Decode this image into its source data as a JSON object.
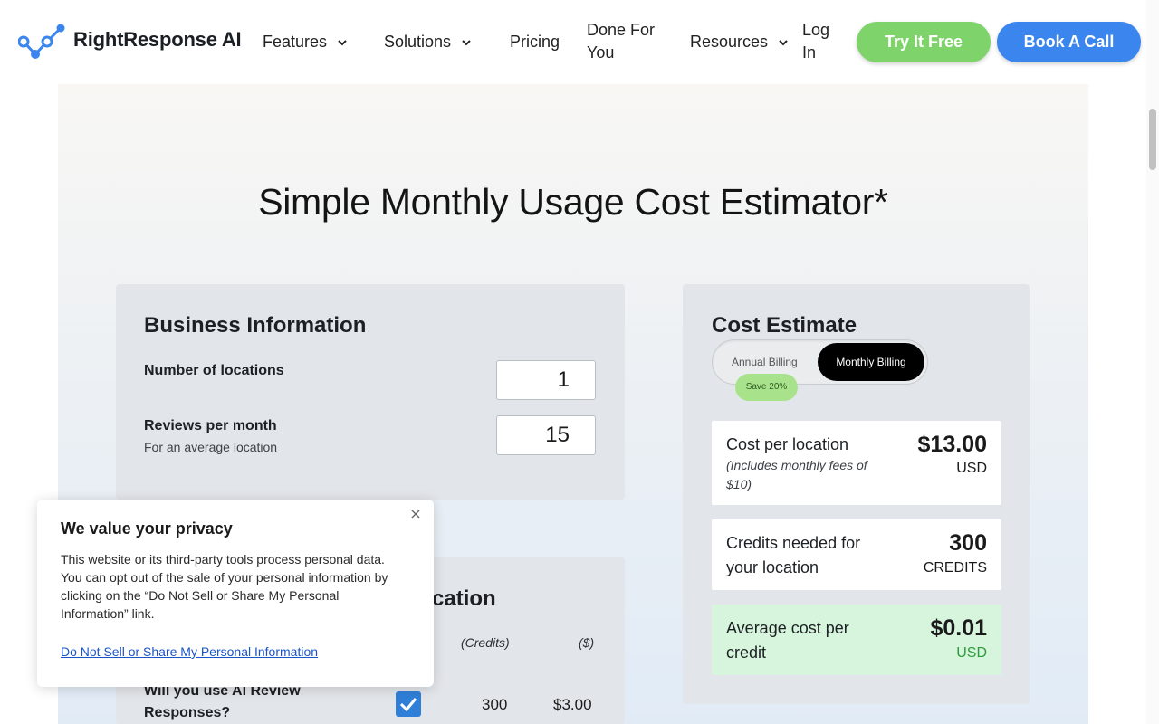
{
  "nav": {
    "brand": "RightResponse AI",
    "items": [
      {
        "label": "Features",
        "has_dropdown": true
      },
      {
        "label": "Solutions",
        "has_dropdown": true
      },
      {
        "label": "Pricing",
        "has_dropdown": false
      },
      {
        "label": "Done For You",
        "has_dropdown": false
      },
      {
        "label": "Resources",
        "has_dropdown": true
      },
      {
        "label": "Log In",
        "has_dropdown": false
      }
    ],
    "try_label": "Try It Free",
    "book_label": "Book A Call",
    "colors": {
      "try": "#7ed36a",
      "book": "#3b86ee",
      "logo": "#3b86ee"
    }
  },
  "hero": {
    "title": "Simple Monthly Usage Cost Estimator*"
  },
  "business": {
    "title": "Business Information",
    "locations_label": "Number of locations",
    "locations_value": "1",
    "reviews_label": "Reviews per month",
    "reviews_sub": "For an average location",
    "reviews_value": "15"
  },
  "per_location": {
    "title_fragment": "cation",
    "col_credits": "(Credits)",
    "col_dollars": "($)",
    "row1_label": "Will you use AI Review Responses?",
    "row1_checked": true,
    "row1_credits": "300",
    "row1_dollars": "$3.00"
  },
  "estimate": {
    "title": "Cost Estimate",
    "annual_label": "Annual Billing",
    "monthly_label": "Monthly Billing",
    "save_label": "Save 20%",
    "selected": "Monthly Billing",
    "cost_per_location_label": "Cost per location",
    "cost_per_location_note": "(Includes monthly fees of $10)",
    "cost_per_location_value": "$13.00",
    "cost_per_location_unit": "USD",
    "credits_label": "Credits needed for your location",
    "credits_value": "300",
    "credits_unit": "CREDITS",
    "avg_label": "Average cost per credit",
    "avg_value": "$0.01",
    "avg_unit": "USD"
  },
  "cookie": {
    "title": "We value your privacy",
    "body": "This website or its third-party tools process personal data. You can opt out of the sale of your personal information by clicking on the “Do Not Sell or Share My Personal Information” link.",
    "link": "Do Not Sell or Share My Personal Information",
    "close_icon": "close-icon"
  }
}
